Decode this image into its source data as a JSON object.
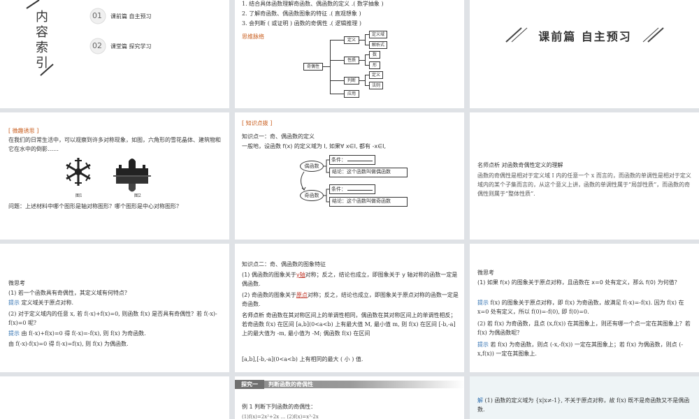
{
  "index": {
    "title": "内容索引",
    "items": [
      {
        "num": "01",
        "label": "课前篇  自主预习"
      },
      {
        "num": "02",
        "label": "课堂篇  探究学习"
      }
    ]
  },
  "objectives": {
    "items": [
      "1. 结合具体函数理解奇函数、偶函数的定义 .( 数学抽象 )",
      "2. 了解奇函数、偶函数图象的特征 .( 直观想象 )",
      "3. 会判断 ( 或证明 ) 函数的奇偶性 .( 逻辑推理 )"
    ],
    "mindmap_title": "思维脉络",
    "mindmap": {
      "root": "奇偶性",
      "branches": [
        "定义",
        "性质",
        "判断",
        "应用"
      ],
      "leaves_def": [
        "定义域",
        "解析式"
      ],
      "leaves_prop": [
        "数",
        "形"
      ],
      "leaves_judge": [
        "定义",
        "法则"
      ]
    }
  },
  "banner": {
    "title": "课前篇  自主预习"
  },
  "intro": {
    "tag": "[ 微趣诱思 ]",
    "text": "在我们的日常生活中，可以观察到许多对称现象，如图，六角形的雪花晶体、建筑物和它在水中的倒影……",
    "fig1": "图1",
    "fig2": "图2",
    "question": "问题：上述材料中哪个图形是轴对称图形？哪个图形是中心对称图形？"
  },
  "kp1": {
    "tag": "[ 知识点拨 ]",
    "heading": "知识点一：奇、偶函数的定义",
    "line": "一般地，设函数 f(x) 的定义域为 I, 如果∀ x∈I, 都有 -x∈I,",
    "even_label": "偶函数",
    "odd_label": "奇函数",
    "cond": "条件：",
    "even_concl": "结论：这个函数叫做偶函数",
    "odd_concl": "结论：这个函数叫做奇函数"
  },
  "analysis": {
    "title": "名师点析  对函数奇偶性定义的理解",
    "text": "函数的奇偶性是相对于定义域 I 内的任意一个 x 而言的，而函数的单调性是相对于定义域内的某个子集而言的，从这个意义上讲，函数的单调性属于“局部性质”，而函数的奇偶性则属于“整体性质”."
  },
  "think1": {
    "title": "微思考",
    "q1": "(1) 若一个函数具有奇偶性，其定义域有何特点？",
    "tip1_label": "提示",
    "tip1": "定义域关于原点对称.",
    "q2": "(2) 对于定义域内的任意 x, 若 f(-x)+f(x)=0, 则函数 f(x) 是否具有奇偶性？若 f(-x)-f(x)=0 呢？",
    "tip2_label": "提示",
    "tip2a": "由 f(-x)+f(x)=0 得 f(-x)=-f(x), 则 f(x) 为奇函数.",
    "tip2b": "由 f(-x)-f(x)=0 得 f(-x)=f(x), 则 f(x) 为偶函数."
  },
  "kp2": {
    "heading": "知识点二：奇、偶函数的图象特征",
    "p1a": "(1) 偶函数的图象关于",
    "blank1": "y轴",
    "p1b": "对称；反之，结论也成立，即图象关于 y 轴对称的函数一定是偶函数.",
    "p2a": "(2) 奇函数的图象关于",
    "blank2": "原点",
    "p2b": "对称；反之，结论也成立，即图象关于原点对称的函数一定是奇函数.",
    "note_title": "名师点析",
    "note": "奇函数在其对称区间上的单调性相同，偶函数在其对称区间上的单调性相反；若奇函数 f(x) 在区间 [a,b](0<a<b) 上有最大值 M, 最小值 m, 则 f(x) 在区间 [-b,-a] 上的最大值为 -m, 最小值为 -M; 偶函数 f(x) 在区间",
    "note2": "[a,b],[-b,-a](0<a<b) 上有相同的最大 ( 小 ) 值."
  },
  "think2": {
    "title": "微思考",
    "q1": "(1) 如果 f(x) 的图象关于原点对称，且函数在 x=0 处有定义，那么 f(0) 为何值？",
    "tip1_label": "提示",
    "tip1": "f(x) 的图象关于原点对称，即 f(x) 为奇函数，故满足 f(-x)=-f(x). 因为 f(x) 在 x=0 处有定义，所以 f(0)=-f(0), 即 f(0)=0.",
    "q2": "(2) 若 f(x) 为奇函数，且点 (x,f(x)) 在其图象上，则还有哪一个点一定在其图象上？若 f(x) 为偶函数呢？",
    "tip2_label": "提示",
    "tip2": "若 f(x) 为奇函数，则点 (-x,-f(x)) 一定在其图象上；若 f(x) 为偶函数，则点 (-x,f(x)) 一定在其图象上."
  },
  "explore": {
    "tag": "探究一",
    "title": "判断函数的奇偶性",
    "ex": "例 1 判断下列函数的奇偶性：",
    "sub": "(1)f(x)=2x²+2x ... (2)f(x)=x³-2x"
  },
  "solution": {
    "label": "解",
    "text": "(1) 函数的定义域为 {x|x≠-1}, 不关于原点对称，故 f(x) 既不是奇函数又不是偶函数."
  },
  "colors": {
    "accent_blue": "#2e6fb0",
    "accent_orange": "#c85c1c",
    "tab_gray": "#8c8c8c"
  }
}
